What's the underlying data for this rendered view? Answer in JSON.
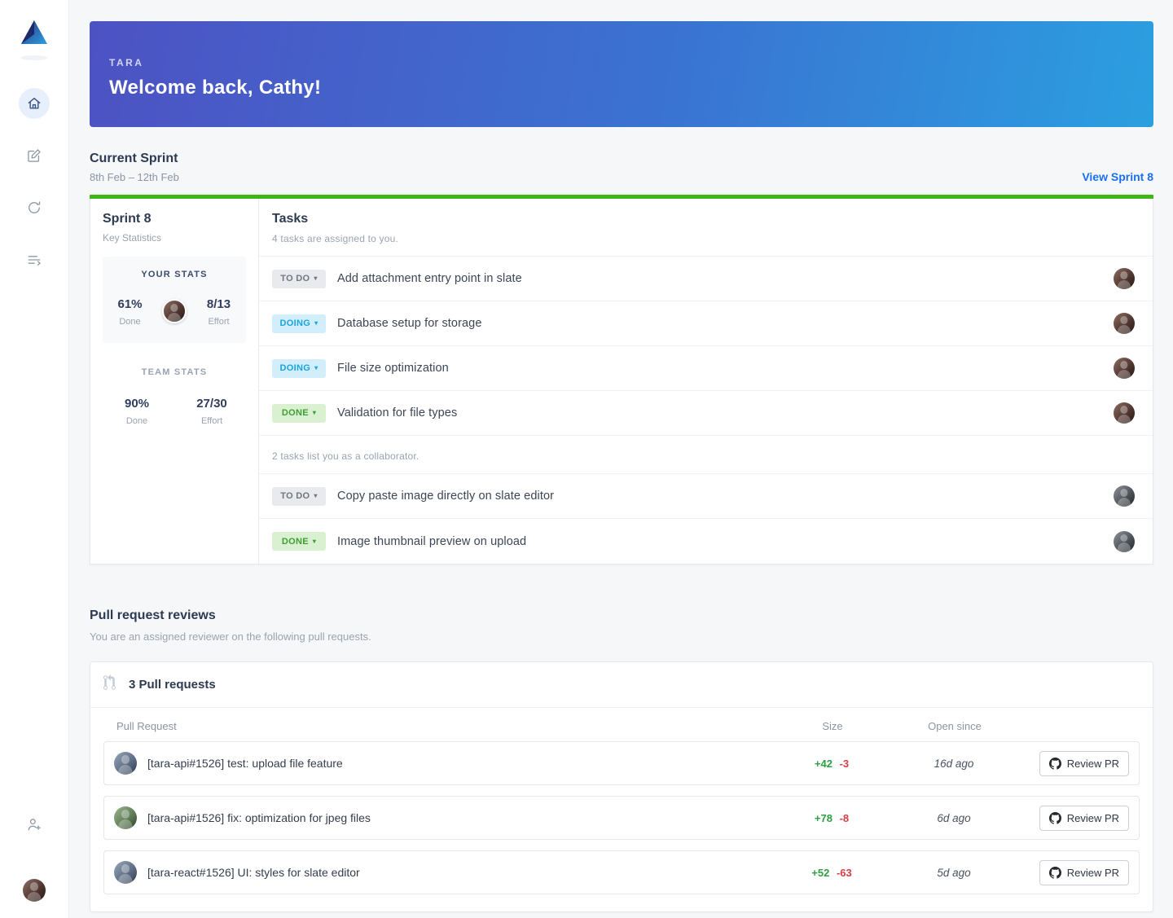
{
  "banner": {
    "app_name": "TARA",
    "welcome": "Welcome back, Cathy!"
  },
  "current_sprint": {
    "title": "Current Sprint",
    "date_range": "8th Feb – 12th Feb",
    "view_link": "View Sprint 8"
  },
  "sprint_card": {
    "title": "Sprint 8",
    "subtitle": "Key Statistics",
    "your_stats": {
      "label": "YOUR STATS",
      "done_value": "61%",
      "done_label": "Done",
      "effort_value": "8/13",
      "effort_label": "Effort"
    },
    "team_stats": {
      "label": "TEAM STATS",
      "done_value": "90%",
      "done_label": "Done",
      "effort_value": "27/30",
      "effort_label": "Effort"
    }
  },
  "tasks": {
    "title": "Tasks",
    "assigned_note": "4 tasks are assigned to you.",
    "collaborator_note": "2 tasks list you as a collaborator.",
    "assigned": [
      {
        "status": "TO DO",
        "label": "Add attachment entry point in slate"
      },
      {
        "status": "DOING",
        "label": "Database setup for storage"
      },
      {
        "status": "DOING",
        "label": "File size optimization"
      },
      {
        "status": "DONE",
        "label": "Validation for file types"
      }
    ],
    "collaborator": [
      {
        "status": "TO DO",
        "label": "Copy paste image directly on slate editor"
      },
      {
        "status": "DONE",
        "label": "Image thumbnail preview on upload"
      }
    ]
  },
  "pull_requests": {
    "section_title": "Pull request reviews",
    "section_subtitle": "You are an assigned reviewer on the following pull requests.",
    "card_title": "3 Pull requests",
    "columns": {
      "pr": "Pull Request",
      "size": "Size",
      "open_since": "Open since"
    },
    "review_label": "Review PR",
    "rows": [
      {
        "title": "[tara-api#1526] test: upload file feature",
        "additions": "+42",
        "deletions": "-3",
        "open_since": "16d ago"
      },
      {
        "title": "[tara-api#1526] fix: optimization for jpeg files",
        "additions": "+78",
        "deletions": "-8",
        "open_since": "6d ago"
      },
      {
        "title": "[tara-react#1526] UI: styles for slate editor",
        "additions": "+52",
        "deletions": "-63",
        "open_since": "5d ago"
      }
    ]
  },
  "colors": {
    "banner_gradient_start": "#4d52c3",
    "banner_gradient_end": "#2b9fe0",
    "progress_green": "#3eb616",
    "link_blue": "#1a6ff0",
    "badge_todo_bg": "#e9eaee",
    "badge_doing_bg": "#d3eefb",
    "badge_doing_text": "#18a5e0",
    "badge_done_bg": "#d9f0d1",
    "badge_done_text": "#3f9e33",
    "additions_green": "#2f9e44",
    "deletions_red": "#d23f44"
  }
}
